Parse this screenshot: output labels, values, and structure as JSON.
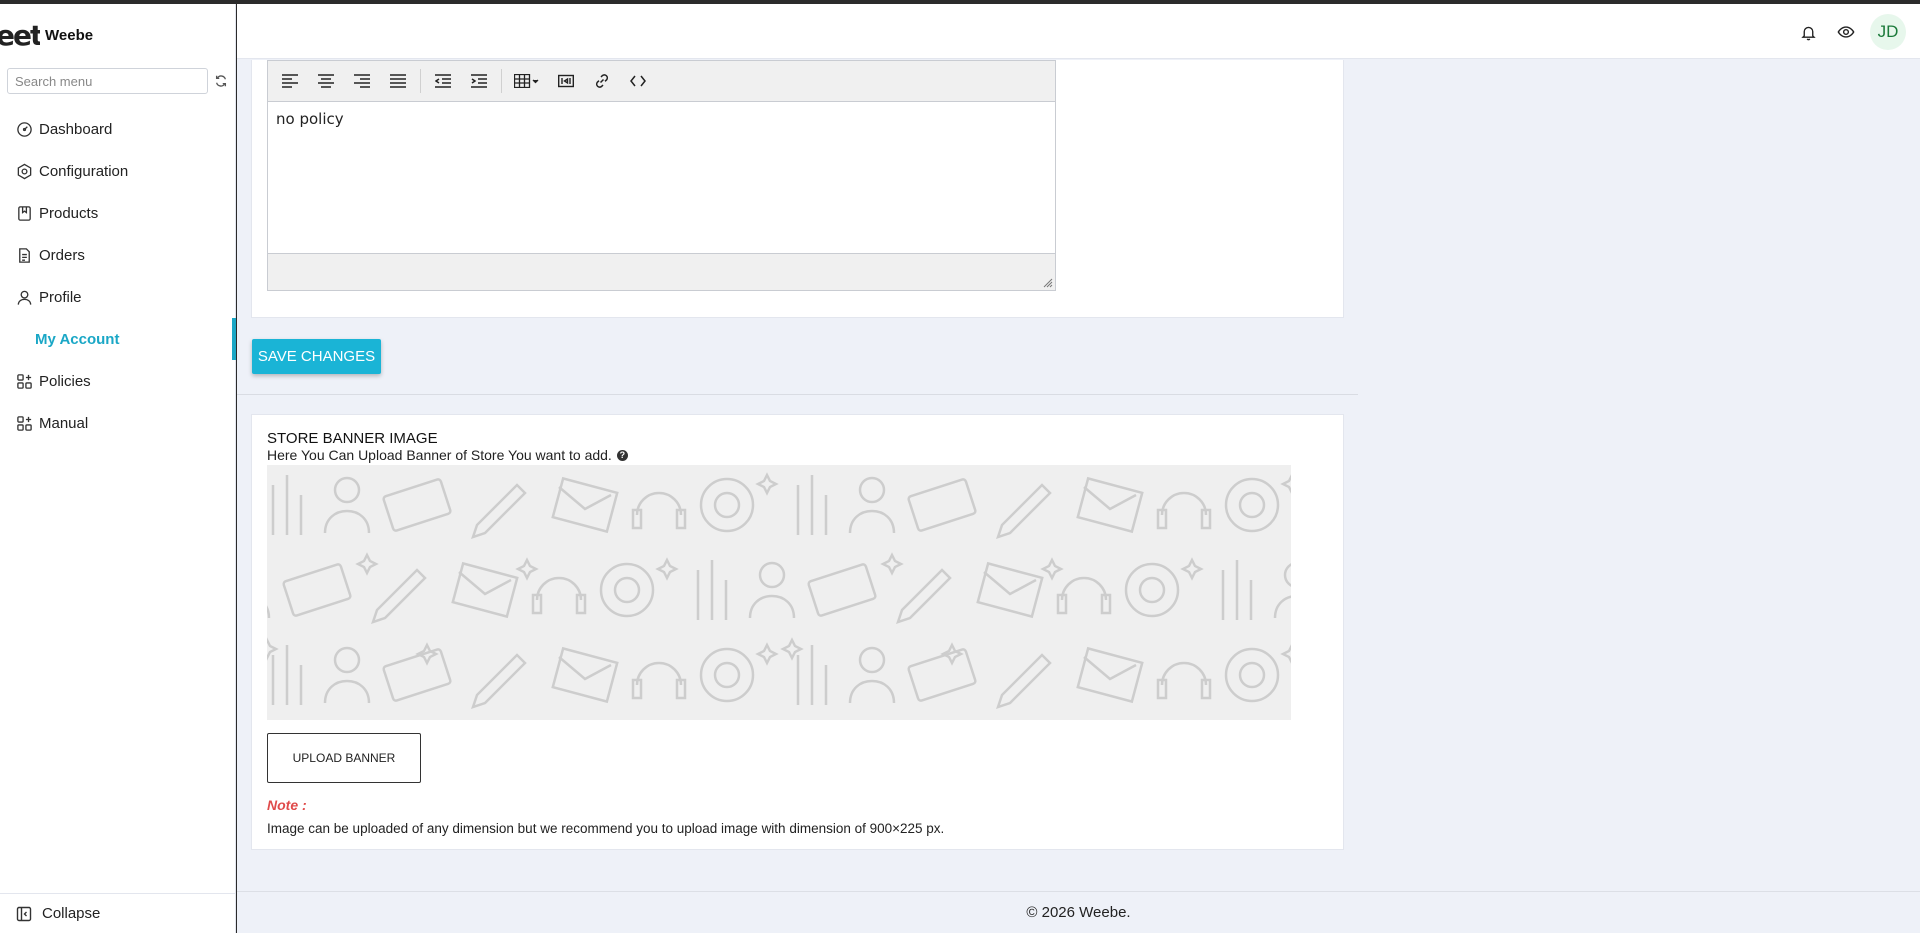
{
  "brand": {
    "logo_text": "eet",
    "name": "Weebe"
  },
  "search": {
    "placeholder": "Search menu",
    "value": ""
  },
  "sidebar": {
    "items": [
      {
        "label": "Dashboard",
        "icon": "dashboard-icon"
      },
      {
        "label": "Configuration",
        "icon": "settings-icon"
      },
      {
        "label": "Products",
        "icon": "bookmark-icon"
      },
      {
        "label": "Orders",
        "icon": "document-icon"
      },
      {
        "label": "Profile",
        "icon": "user-icon"
      },
      {
        "label": "My Account",
        "icon": "",
        "active": true
      },
      {
        "label": "Policies",
        "icon": "grid-plus-icon"
      },
      {
        "label": "Manual",
        "icon": "grid-plus-icon"
      }
    ],
    "collapse_label": "Collapse"
  },
  "header": {
    "avatar_initials": "JD"
  },
  "editor": {
    "content": "no policy",
    "toolbar": [
      "align-left-icon",
      "align-center-icon",
      "align-right-icon",
      "align-justify-icon",
      "outdent-icon",
      "indent-icon",
      "table-icon",
      "media-icon",
      "link-icon",
      "code-icon"
    ]
  },
  "save_button": "SAVE CHANGES",
  "banner": {
    "title": "STORE BANNER IMAGE",
    "subtitle": "Here You Can Upload Banner of Store You want to add.",
    "upload_label": "UPLOAD BANNER",
    "note_label": "Note :",
    "note_text": "Image can be uploaded of any dimension but we recommend you to upload image with dimension of 900×225 px."
  },
  "footer": {
    "text": "© 2026 Weebe."
  },
  "colors": {
    "accent": "#1ab4d6",
    "note": "#e04b4b",
    "background": "#eef1f8"
  }
}
